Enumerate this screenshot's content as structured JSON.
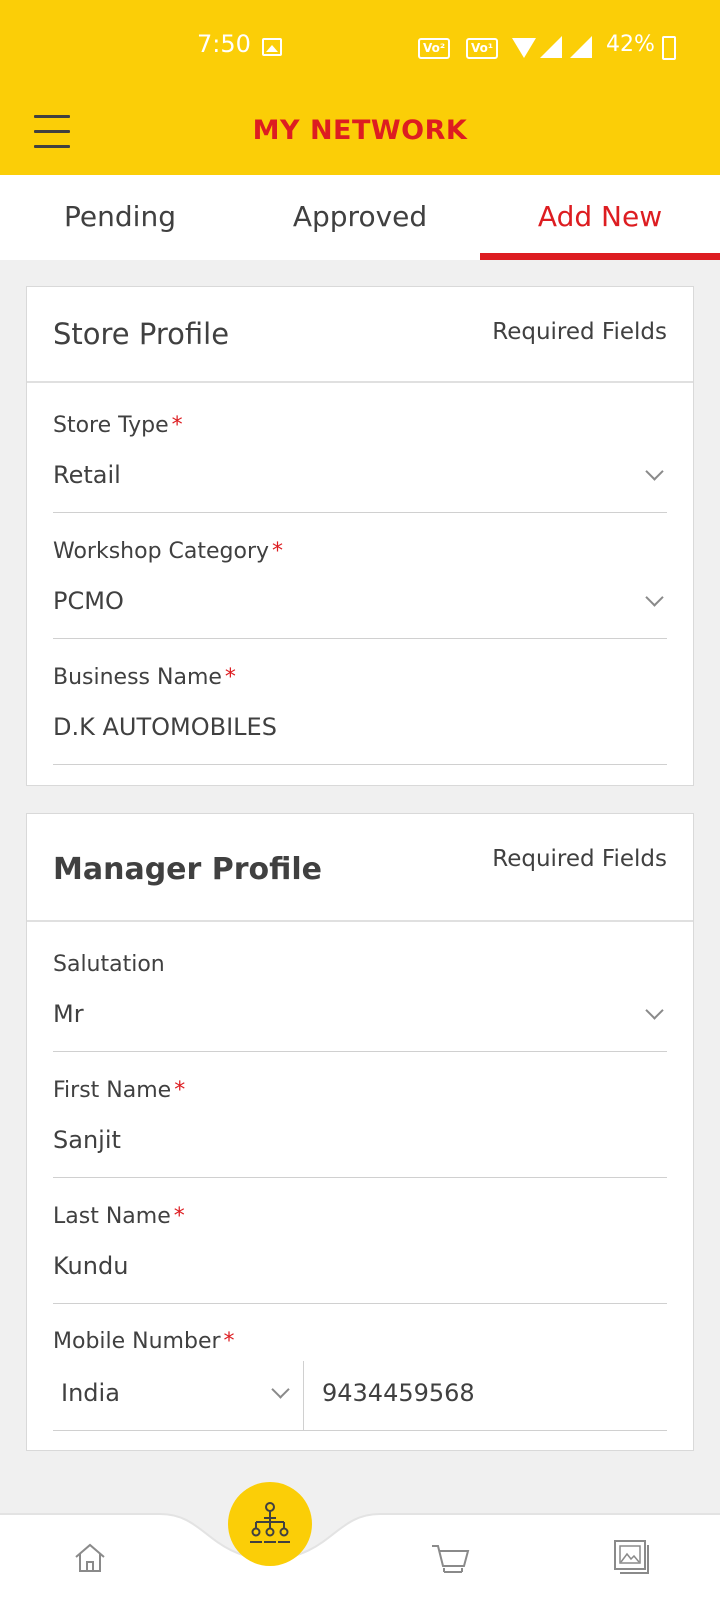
{
  "status_bar": {
    "time": "7:50",
    "badge1": "Vo WiFi 2",
    "badge2": "Vo LTE 1",
    "battery": "42%"
  },
  "app_bar": {
    "title": "MY NETWORK",
    "menu_icon": "hamburger-menu-icon"
  },
  "tabs": [
    {
      "label": "Pending",
      "active": false
    },
    {
      "label": "Approved",
      "active": false
    },
    {
      "label": "Add New",
      "active": true
    }
  ],
  "store_profile": {
    "title": "Store Profile",
    "required_note": "Required Fields",
    "fields": {
      "store_type": {
        "label": "Store Type",
        "value": "Retail"
      },
      "workshop_category": {
        "label": "Workshop Category",
        "value": "PCMO"
      },
      "business_name": {
        "label": "Business Name",
        "value": "D.K AUTOMOBILES"
      }
    }
  },
  "manager_profile": {
    "title": "Manager Profile",
    "required_note": "Required Fields",
    "fields": {
      "salutation": {
        "label": "Salutation",
        "value": "Mr"
      },
      "first_name": {
        "label": "First Name",
        "value": "Sanjit"
      },
      "last_name": {
        "label": "Last Name",
        "value": "Kundu"
      },
      "mobile": {
        "label": "Mobile Number",
        "country": "India",
        "number": "9434459568"
      }
    }
  },
  "bottom_nav": {
    "items": [
      "home-icon",
      "network-icon",
      "cart-icon",
      "gallery-icon"
    ],
    "active": "network-icon"
  },
  "colors": {
    "brand_yellow": "#fbce07",
    "brand_red": "#dd1d21",
    "text": "#404040"
  }
}
